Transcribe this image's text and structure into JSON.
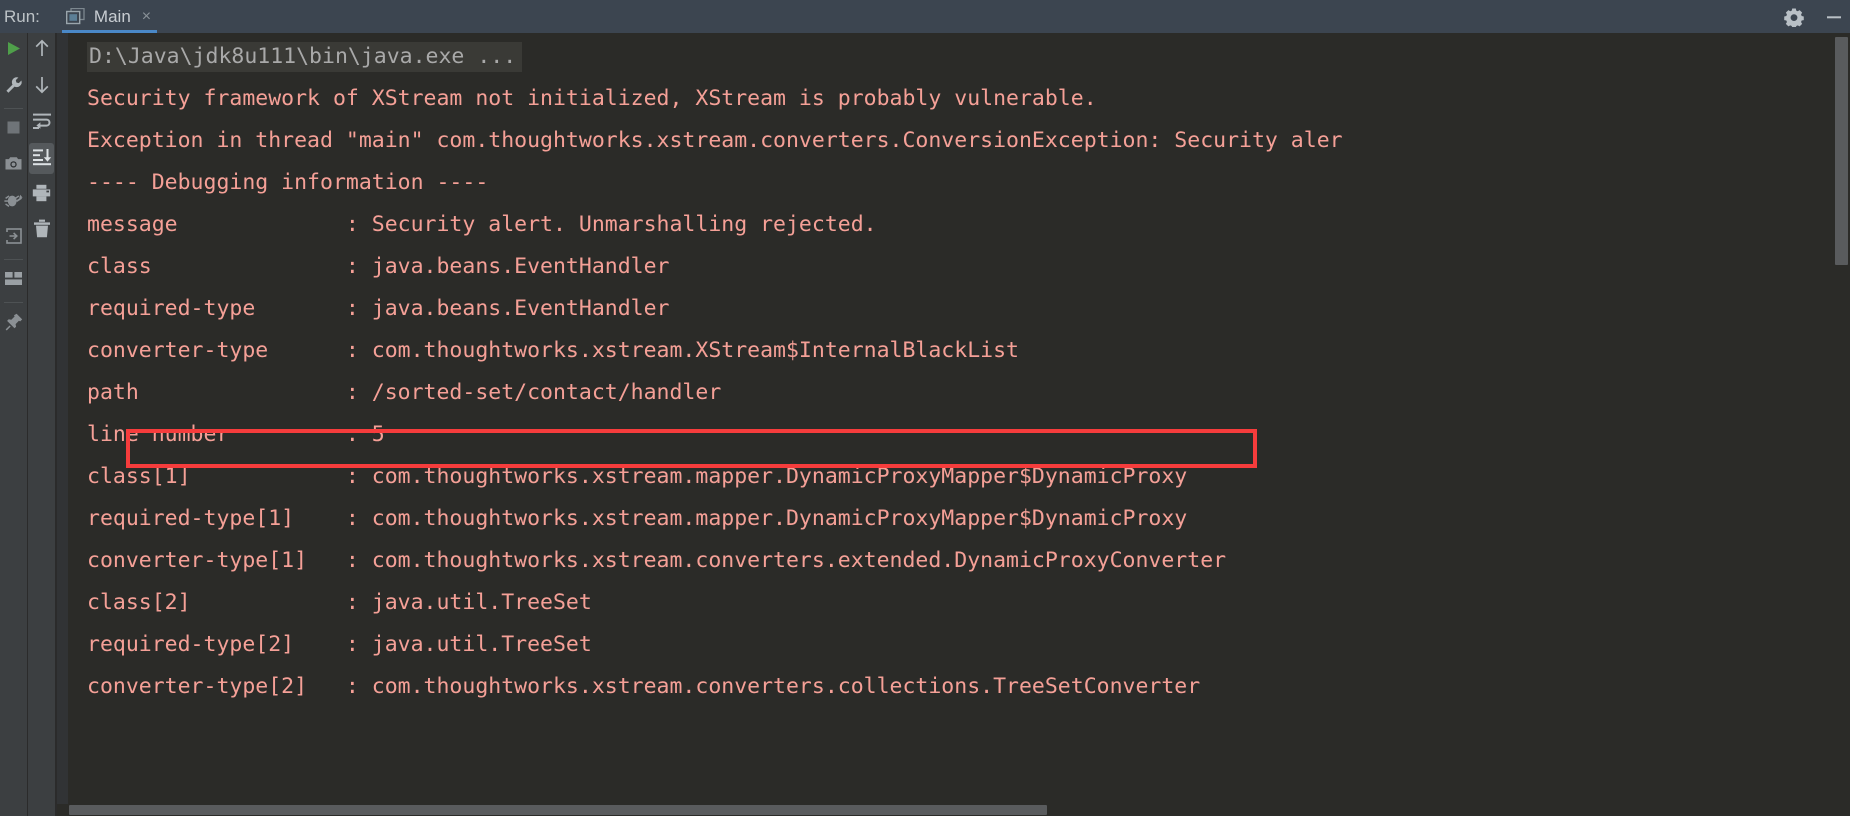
{
  "window": {
    "run_label": "Run:",
    "tab_label": "Main",
    "tab_close": "×",
    "tab_icon": "run-configuration-icon",
    "gear_icon": "gear-icon",
    "minimize_icon": "minimize-icon"
  },
  "colors": {
    "topbar_bg": "#3c4550",
    "tab_underline": "#4a88c7",
    "toolbar_bg": "#3c3f41",
    "console_bg": "#2b2b28",
    "error_text": "#f5a097",
    "command_text": "#a9a9a9",
    "highlight_box": "#f63c3c",
    "run_green": "#4f9f4a",
    "scrollbar": "#595b5d"
  },
  "left_toolbar_primary": [
    {
      "name": "rerun-button",
      "icon": "play-icon",
      "label": "Rerun",
      "active": false
    },
    {
      "name": "settings-wrench-button",
      "icon": "wrench-icon",
      "label": "Edit Configuration",
      "active": false
    },
    {
      "name": "stop-button",
      "icon": "stop-square-icon",
      "label": "Stop",
      "active": false
    },
    {
      "name": "screenshot-button",
      "icon": "camera-icon",
      "label": "Screenshot",
      "active": false
    },
    {
      "name": "debug-button",
      "icon": "bug-icon",
      "label": "Debug",
      "active": false
    },
    {
      "name": "attach-button",
      "icon": "attach-arrow-icon",
      "label": "Attach",
      "active": false
    },
    {
      "name": "layout-button",
      "icon": "layout-icon",
      "label": "Layout",
      "active": false
    },
    {
      "name": "pin-button",
      "icon": "pin-icon",
      "label": "Pin Tab",
      "active": false
    }
  ],
  "left_toolbar_secondary": [
    {
      "name": "prev-occurrence-button",
      "icon": "arrow-up-icon",
      "label": "Up the Stack Trace",
      "active": false
    },
    {
      "name": "next-occurrence-button",
      "icon": "arrow-down-icon",
      "label": "Down the Stack Trace",
      "active": false
    },
    {
      "name": "soft-wrap-button",
      "icon": "soft-wrap-icon",
      "label": "Soft-Wrap",
      "active": false
    },
    {
      "name": "scroll-to-end-button",
      "icon": "scroll-to-end-icon",
      "label": "Scroll to the End",
      "active": true
    },
    {
      "name": "print-button",
      "icon": "printer-icon",
      "label": "Print",
      "active": false
    },
    {
      "name": "clear-all-button",
      "icon": "trash-icon",
      "label": "Clear All",
      "active": false
    }
  ],
  "console": {
    "highlighted_line_index": 7,
    "lines": [
      {
        "text": "D:\\Java\\jdk8u111\\bin\\java.exe ...",
        "type": "command"
      },
      {
        "text": "Security framework of XStream not initialized, XStream is probably vulnerable.",
        "type": "error"
      },
      {
        "text": "Exception in thread \"main\" com.thoughtworks.xstream.converters.ConversionException: Security aler",
        "type": "error"
      },
      {
        "text": "---- Debugging information ----",
        "type": "error"
      },
      {
        "text": "message             : Security alert. Unmarshalling rejected.",
        "type": "error"
      },
      {
        "text": "class               : java.beans.EventHandler",
        "type": "error"
      },
      {
        "text": "required-type       : java.beans.EventHandler",
        "type": "error"
      },
      {
        "text": "converter-type      : com.thoughtworks.xstream.XStream$InternalBlackList",
        "type": "error"
      },
      {
        "text": "path                : /sorted-set/contact/handler",
        "type": "error"
      },
      {
        "text": "line number         : 5",
        "type": "error"
      },
      {
        "text": "class[1]            : com.thoughtworks.xstream.mapper.DynamicProxyMapper$DynamicProxy",
        "type": "error"
      },
      {
        "text": "required-type[1]    : com.thoughtworks.xstream.mapper.DynamicProxyMapper$DynamicProxy",
        "type": "error"
      },
      {
        "text": "converter-type[1]   : com.thoughtworks.xstream.converters.extended.DynamicProxyConverter",
        "type": "error"
      },
      {
        "text": "class[2]            : java.util.TreeSet",
        "type": "error"
      },
      {
        "text": "required-type[2]    : java.util.TreeSet",
        "type": "error"
      },
      {
        "text": "converter-type[2]   : com.thoughtworks.xstream.converters.collections.TreeSetConverter",
        "type": "error"
      }
    ]
  }
}
